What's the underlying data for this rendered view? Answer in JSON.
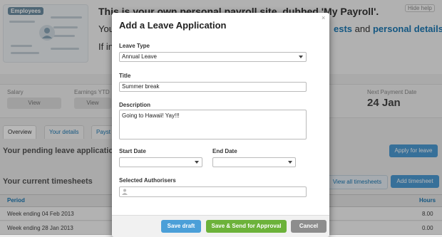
{
  "background": {
    "employees_card_title": "Employees",
    "hide_help": "Hide help",
    "heading": "This is your own personal payroll site, dubbed 'My Payroll'.",
    "line2_prefix": "You",
    "line2_link1": "ests",
    "line2_and": "and",
    "line2_link2": "personal details",
    "line2_suffix": ".",
    "line3_prefix": "If in",
    "stats": {
      "salary_label": "Salary",
      "salary_button": "View",
      "earnings_label": "Earnings YTD",
      "earnings_button": "View",
      "next_payment_label": "Next Payment Date",
      "next_payment_value": "24 Jan"
    },
    "tabs": [
      {
        "label": "Overview"
      },
      {
        "label": "Your details"
      },
      {
        "label": "Payst"
      }
    ],
    "pending_heading": "Your pending leave applications",
    "apply_button": "Apply for leave",
    "timesheets_heading": "Your current timesheets",
    "view_all_button": "View all timesheets",
    "add_timesheet_button": "Add timesheet",
    "table": {
      "col_period": "Period",
      "col_hours": "Hours",
      "rows": [
        {
          "period": "Week ending 04 Feb 2013",
          "hours": "8.00"
        },
        {
          "period": "Week ending 28 Jan 2013",
          "hours": "0.00"
        }
      ]
    }
  },
  "modal": {
    "title": "Add a Leave Application",
    "close": "×",
    "leave_type_label": "Leave Type",
    "leave_type_value": "Annual Leave",
    "title_label": "Title",
    "title_value": "Summer break",
    "description_label": "Description",
    "description_value": "Going to Hawaii! Yay!!!",
    "start_date_label": "Start Date",
    "start_date_value": "",
    "end_date_label": "End Date",
    "end_date_value": "",
    "authorisers_label": "Selected Authorisers",
    "save_draft": "Save draft",
    "save_send": "Save & Send for Approval",
    "cancel": "Cancel"
  },
  "colors": {
    "link": "#1c79b4",
    "primary_button": "#4b9fd8",
    "approve_button": "#6cb23a",
    "cancel_button": "#8d8d8d"
  }
}
